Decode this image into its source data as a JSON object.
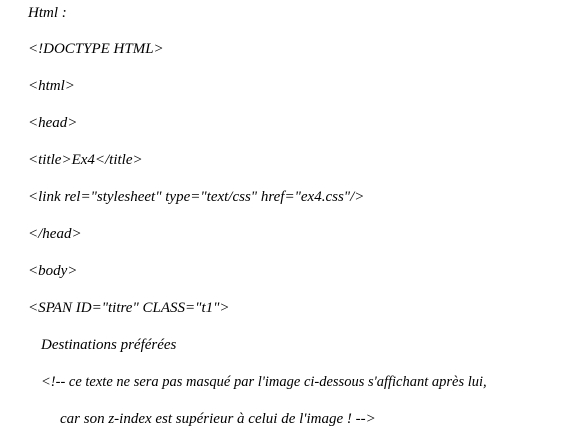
{
  "document": {
    "lines": [
      "Html :",
      "<!DOCTYPE HTML>",
      "<html>",
      "<head>",
      "<title>Ex4</title>",
      "<link rel=\"stylesheet\" type=\"text/css\" href=\"ex4.css\"/>",
      "</head>",
      "<body>",
      "<SPAN ID=\"titre\" CLASS=\"t1\">",
      "Destinations préférées",
      "<!-- ce texte ne sera pas masqué par l'image ci-dessous s'affichant après lui,",
      "car son z-index est supérieur à celui de l'image ! -->"
    ]
  }
}
